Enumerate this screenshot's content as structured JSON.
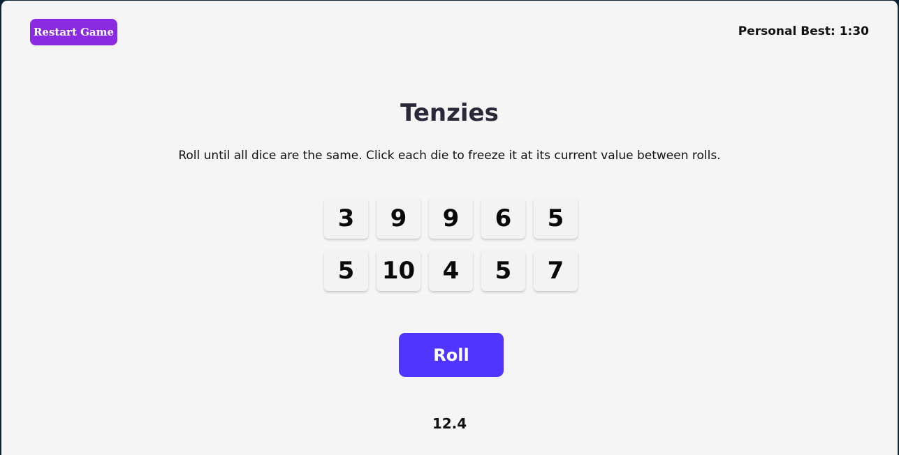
{
  "header": {
    "restart_label": "Restart Game",
    "personal_best_label": "Personal Best:",
    "personal_best_value": "1:30"
  },
  "game": {
    "title": "Tenzies",
    "instructions": "Roll until all dice are the same. Click each die to freeze it at its current value between rolls.",
    "dice": [
      "3",
      "9",
      "9",
      "6",
      "5",
      "5",
      "10",
      "4",
      "5",
      "7"
    ],
    "roll_label": "Roll",
    "timer": "12.4"
  },
  "colors": {
    "background": "#f5f5f5",
    "restart_button": "#8a2be2",
    "roll_button": "#5035ff",
    "title_text": "#2b283a"
  }
}
